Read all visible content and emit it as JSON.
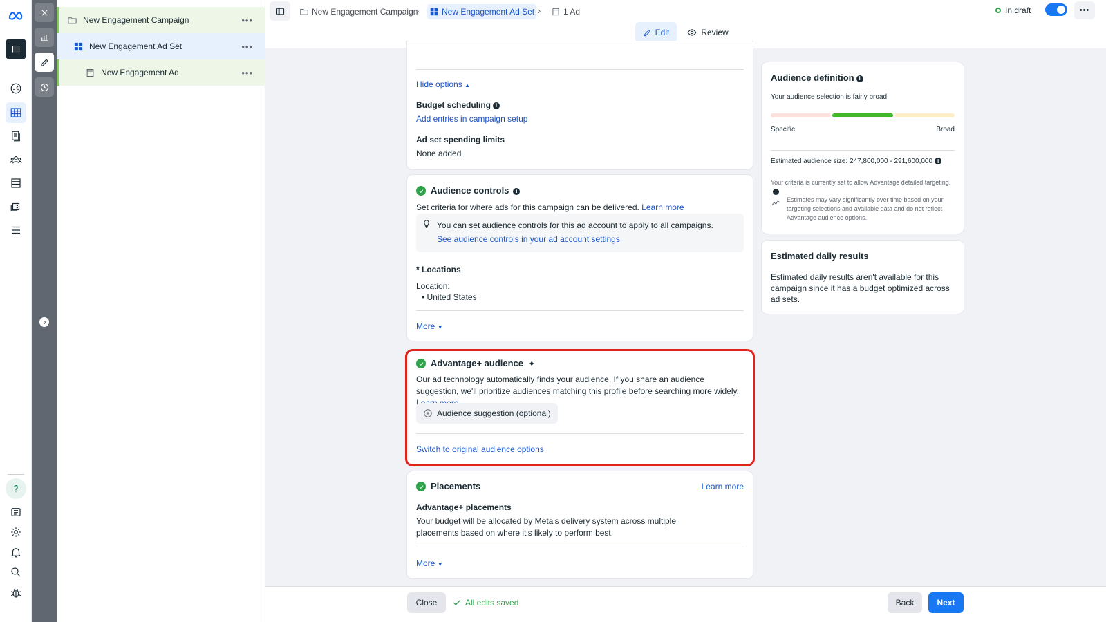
{
  "tree": {
    "campaign": "New Engagement Campaign",
    "adset": "New Engagement Ad Set",
    "ad": "New Engagement Ad"
  },
  "breadcrumb": {
    "campaign": "New Engagement Campaign",
    "adset": "New Engagement Ad Set",
    "ad": "1 Ad"
  },
  "status": {
    "label": "In draft"
  },
  "tabs": {
    "edit": "Edit",
    "review": "Review"
  },
  "budget": {
    "hide_options": "Hide options",
    "scheduling_title": "Budget scheduling",
    "scheduling_link": "Add entries in campaign setup",
    "limits_title": "Ad set spending limits",
    "limits_value": "None added"
  },
  "audience_controls": {
    "title": "Audience controls",
    "desc": "Set criteria for where ads for this campaign can be delivered.",
    "learn_more": "Learn more",
    "tip": "You can set audience controls for this ad account to apply to all campaigns.",
    "tip_link": "See audience controls in your ad account settings",
    "locations_title": "* Locations",
    "location_label": "Location:",
    "location_value": "United States",
    "more": "More"
  },
  "advantage": {
    "title": "Advantage+ audience",
    "desc": "Our ad technology automatically finds your audience. If you share an audience suggestion, we'll prioritize audiences matching this profile before searching more widely.",
    "learn_more": "Learn more",
    "suggestion_button": "Audience suggestion (optional)",
    "switch_link": "Switch to original audience options"
  },
  "placements": {
    "title": "Placements",
    "learn_more": "Learn more",
    "sub_title": "Advantage+ placements",
    "desc": "Your budget will be allocated by Meta's delivery system across multiple placements based on where it's likely to perform best.",
    "more": "More"
  },
  "audience_definition": {
    "title": "Audience definition",
    "breadth": "Your audience selection is fairly broad.",
    "specific": "Specific",
    "broad": "Broad",
    "size_label": "Estimated audience size: 247,800,000 - 291,600,000",
    "criteria": "Your criteria is currently set to allow Advantage detailed targeting.",
    "estimates": "Estimates may vary significantly over time based on your targeting selections and available data and do not reflect Advantage audience options."
  },
  "daily_results": {
    "title": "Estimated daily results",
    "desc": "Estimated daily results aren't available for this campaign since it has a budget optimized across ad sets."
  },
  "footer": {
    "close": "Close",
    "saved": "All edits saved",
    "back": "Back",
    "next": "Next"
  },
  "colors": {
    "accent": "#1877f2",
    "link": "#1a56c9",
    "success": "#31a24c",
    "highlight_border": "#e0241b"
  }
}
